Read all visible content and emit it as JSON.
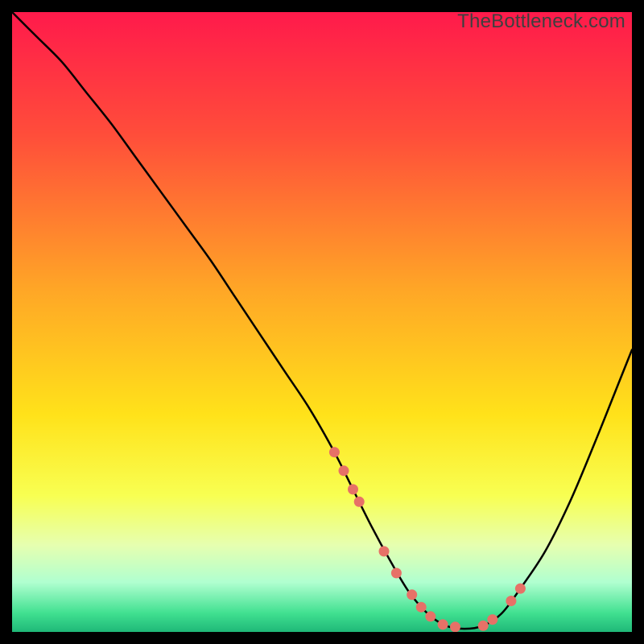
{
  "watermark": "TheBottleneck.com",
  "chart_data": {
    "type": "line",
    "title": "",
    "xlabel": "",
    "ylabel": "",
    "xlim": [
      0,
      100
    ],
    "ylim": [
      0,
      100
    ],
    "grid": false,
    "legend": false,
    "background_gradient": {
      "stops": [
        {
          "pos": 0.0,
          "color": "#ff1a4b"
        },
        {
          "pos": 0.2,
          "color": "#ff4e3a"
        },
        {
          "pos": 0.45,
          "color": "#ffa726"
        },
        {
          "pos": 0.65,
          "color": "#ffe21a"
        },
        {
          "pos": 0.78,
          "color": "#f8ff52"
        },
        {
          "pos": 0.86,
          "color": "#e6ffb0"
        },
        {
          "pos": 0.92,
          "color": "#b0ffd0"
        },
        {
          "pos": 0.97,
          "color": "#40e090"
        },
        {
          "pos": 1.0,
          "color": "#1fb878"
        }
      ]
    },
    "series": [
      {
        "name": "bottleneck-curve",
        "color": "#000000",
        "x": [
          0,
          4,
          8,
          12,
          16,
          20,
          24,
          28,
          32,
          36,
          40,
          44,
          48,
          52,
          55,
          58,
          61,
          64,
          67,
          70,
          73,
          76,
          79,
          82,
          86,
          90,
          94,
          98,
          100
        ],
        "y": [
          100,
          96,
          92,
          87,
          82,
          76.5,
          71,
          65.5,
          60,
          54,
          48,
          42,
          36,
          29,
          23,
          17,
          11.5,
          6.5,
          3,
          1,
          0.5,
          1,
          3,
          7,
          13,
          21,
          30.5,
          40.5,
          45.5
        ]
      },
      {
        "name": "highlight-dots",
        "color": "#e77167",
        "type": "scatter",
        "x": [
          52,
          53.5,
          55,
          56,
          60,
          62,
          64.5,
          66,
          67.5,
          69.5,
          71.5,
          76,
          77.5,
          80.5,
          82
        ],
        "y": [
          29,
          26,
          23,
          21,
          13,
          9.5,
          6,
          4,
          2.5,
          1.2,
          0.8,
          1,
          2,
          5,
          7
        ]
      }
    ]
  }
}
